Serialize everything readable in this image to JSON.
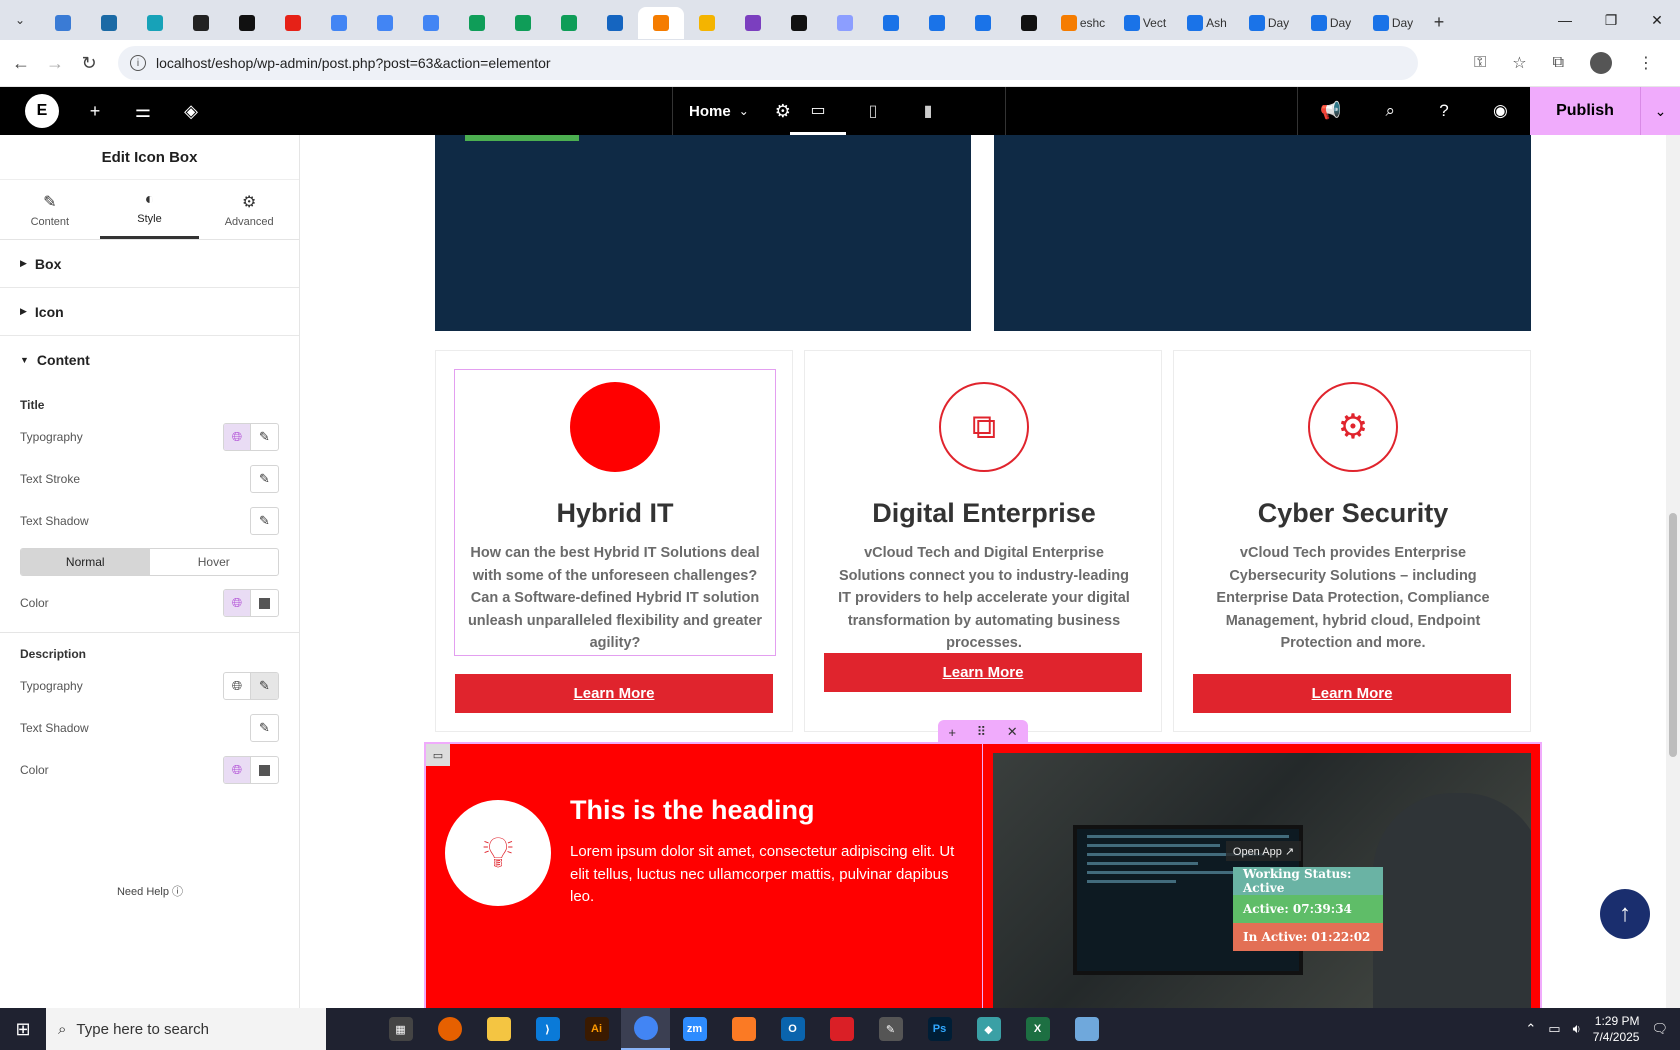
{
  "browser": {
    "tabs": [
      {
        "label": "",
        "color": "#3a7bd5"
      },
      {
        "label": "",
        "color": "#1b6aa5"
      },
      {
        "label": "",
        "color": "#17a2b8"
      },
      {
        "label": "",
        "color": "#222222"
      },
      {
        "label": "",
        "color": "#111111"
      },
      {
        "label": "",
        "color": "#e62117"
      },
      {
        "label": "",
        "color": "#4285f4"
      },
      {
        "label": "",
        "color": "#4285f4"
      },
      {
        "label": "",
        "color": "#4285f4"
      },
      {
        "label": "",
        "color": "#0f9d58"
      },
      {
        "label": "",
        "color": "#0f9d58"
      },
      {
        "label": "",
        "color": "#0f9d58"
      },
      {
        "label": "",
        "color": "#1565c0"
      },
      {
        "label": "",
        "color": "#f57c00",
        "active": true
      },
      {
        "label": "",
        "color": "#f4b400"
      },
      {
        "label": "",
        "color": "#7b3fbf"
      },
      {
        "label": "",
        "color": "#111111"
      },
      {
        "label": "",
        "color": "#8c9eff"
      },
      {
        "label": "",
        "color": "#1a73e8"
      },
      {
        "label": "",
        "color": "#1a73e8"
      },
      {
        "label": "",
        "color": "#1a73e8"
      },
      {
        "label": "",
        "color": "#111111"
      },
      {
        "label": "eshc",
        "color": "#f57c00"
      },
      {
        "label": "Vect",
        "color": "#1a73e8"
      },
      {
        "label": "Ash",
        "color": "#1a73e8"
      },
      {
        "label": "Day",
        "color": "#1a73e8"
      },
      {
        "label": "Day",
        "color": "#1a73e8"
      },
      {
        "label": "Day",
        "color": "#1a73e8"
      }
    ],
    "url": "localhost/eshop/wp-admin/post.php?post=63&action=elementor"
  },
  "topbar": {
    "page_name": "Home",
    "publish_label": "Publish"
  },
  "panel": {
    "title": "Edit Icon Box",
    "tabs": [
      {
        "label": "Content",
        "icon": "pencil-icon"
      },
      {
        "label": "Style",
        "icon": "half-circle-icon",
        "active": true
      },
      {
        "label": "Advanced",
        "icon": "gear-icon"
      }
    ],
    "sections": {
      "box": "Box",
      "icon": "Icon",
      "content": "Content"
    },
    "title_group": {
      "heading": "Title",
      "typography": "Typography",
      "text_stroke": "Text Stroke",
      "text_shadow": "Text Shadow",
      "toggle_normal": "Normal",
      "toggle_hover": "Hover",
      "color": "Color"
    },
    "description_group": {
      "heading": "Description",
      "typography": "Typography",
      "text_shadow": "Text Shadow",
      "color": "Color"
    },
    "need_help": "Need Help"
  },
  "canvas": {
    "cards": [
      {
        "title": "Hybrid IT",
        "description": "How can the best Hybrid IT Solutions deal with some of the unforeseen challenges? Can a Software-defined Hybrid IT solution unleash unparalleled flexibility and greater agility?",
        "button": "Learn More",
        "icon": "red-circle-icon"
      },
      {
        "title": "Digital Enterprise",
        "description": "vCloud Tech and Digital Enterprise Solutions connect you to industry-leading IT providers to help accelerate your digital transformation by automating business processes.",
        "button": "Learn More",
        "icon": "puzzle-icon"
      },
      {
        "title": "Cyber Security",
        "description": "vCloud Tech provides Enterprise Cybersecurity Solutions – including Enterprise Data Protection, Compliance Management, hybrid cloud, Endpoint Protection and more.",
        "button": "Learn More",
        "icon": "hands-gear-icon"
      }
    ],
    "red_section": {
      "heading": "This is the heading",
      "text": "Lorem ipsum dolor sit amet, consectetur adipiscing elit. Ut elit tellus, luctus nec ullamcorper mattis, pulvinar dapibus leo."
    },
    "overlay": {
      "open_app": "Open App ↗",
      "working_status": "Working Status: Active",
      "active_time": "Active: 07:39:34",
      "inactive_time": "In Active: 01:22:02"
    }
  },
  "taskbar": {
    "search_placeholder": "Type here to search",
    "time": "1:29 PM",
    "date": "7/4/2025"
  },
  "colors": {
    "accent_pink": "#f0abfc",
    "brand_red": "#e0242d",
    "navy": "#0f2a45"
  }
}
